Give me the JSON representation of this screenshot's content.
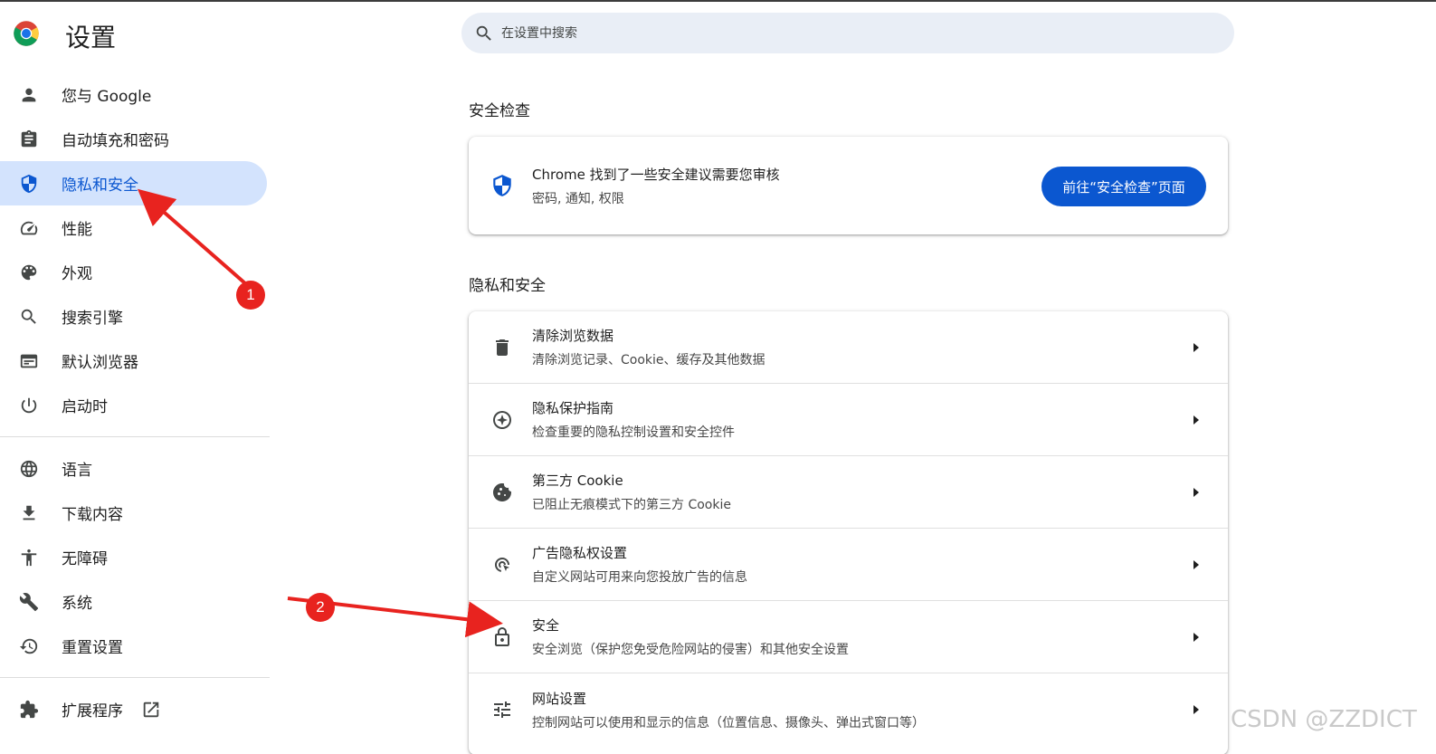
{
  "header": {
    "title": "设置",
    "search_placeholder": "在设置中搜索"
  },
  "sidebar": {
    "items": [
      {
        "label": "您与 Google",
        "icon": "person-icon"
      },
      {
        "label": "自动填充和密码",
        "icon": "clipboard-icon"
      },
      {
        "label": "隐私和安全",
        "icon": "shield-icon",
        "active": true
      },
      {
        "label": "性能",
        "icon": "speedometer-icon"
      },
      {
        "label": "外观",
        "icon": "palette-icon"
      },
      {
        "label": "搜索引擎",
        "icon": "search-icon"
      },
      {
        "label": "默认浏览器",
        "icon": "browser-icon"
      },
      {
        "label": "启动时",
        "icon": "power-icon"
      }
    ],
    "items2": [
      {
        "label": "语言",
        "icon": "globe-icon"
      },
      {
        "label": "下载内容",
        "icon": "download-icon"
      },
      {
        "label": "无障碍",
        "icon": "accessibility-icon"
      },
      {
        "label": "系统",
        "icon": "wrench-icon"
      },
      {
        "label": "重置设置",
        "icon": "history-icon"
      }
    ],
    "extensions": {
      "label": "扩展程序",
      "icon": "puzzle-icon"
    }
  },
  "safety_check": {
    "section_title": "安全检查",
    "main": "Chrome 找到了一些安全建议需要您审核",
    "sub": "密码, 通知, 权限",
    "button": "前往“安全检查”页面"
  },
  "privacy": {
    "section_title": "隐私和安全",
    "rows": [
      {
        "title": "清除浏览数据",
        "sub": "清除浏览记录、Cookie、缓存及其他数据",
        "icon": "trash-icon"
      },
      {
        "title": "隐私保护指南",
        "sub": "检查重要的隐私控制设置和安全控件",
        "icon": "compass-icon"
      },
      {
        "title": "第三方 Cookie",
        "sub": "已阻止无痕模式下的第三方 Cookie",
        "icon": "cookie-icon"
      },
      {
        "title": "广告隐私权设置",
        "sub": "自定义网站可用来向您投放广告的信息",
        "icon": "ad-privacy-icon"
      },
      {
        "title": "安全",
        "sub": "安全浏览（保护您免受危险网站的侵害）和其他安全设置",
        "icon": "lock-icon"
      },
      {
        "title": "网站设置",
        "sub": "控制网站可以使用和显示的信息（位置信息、摄像头、弹出式窗口等）",
        "icon": "sliders-icon"
      }
    ]
  },
  "annotations": {
    "badge1": "1",
    "badge2": "2",
    "color": "#e8231f"
  },
  "watermark": "CSDN @ZZDICT",
  "colors": {
    "accent": "#0b57d0",
    "active_bg": "#d3e3fd",
    "search_bg": "#e9eef6"
  }
}
